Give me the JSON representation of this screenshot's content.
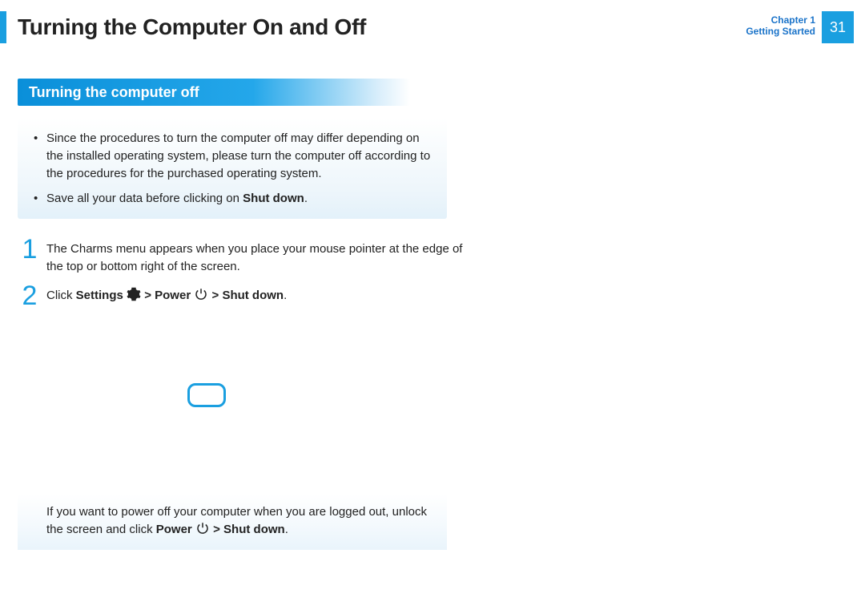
{
  "header": {
    "title": "Turning the Computer On and Off",
    "chapter_line1": "Chapter 1",
    "chapter_line2": "Getting Started",
    "page_number": "31"
  },
  "section": {
    "title": "Turning the computer off"
  },
  "note": {
    "bullets": [
      {
        "before": "Since the procedures to turn the computer off may differ depending on the installed operating system, please turn the computer off according to the procedures for the purchased operating system."
      },
      {
        "before": "Save all your data before clicking on ",
        "bold": "Shut down",
        "after": "."
      }
    ]
  },
  "steps": {
    "1": {
      "num": "1",
      "text": "The Charms menu appears when you place your mouse pointer at the edge of the top or bottom right of the screen."
    },
    "2": {
      "num": "2",
      "click": "Click ",
      "settings": "Settings",
      "sep1": " > ",
      "power": "Power",
      "sep2": " > ",
      "shutdown": "Shut down",
      "period": "."
    }
  },
  "tip": {
    "before": "If you want to power off your computer when you are logged out, unlock the screen and click ",
    "power": "Power",
    "sep": " > ",
    "shutdown": "Shut down",
    "period": "."
  }
}
